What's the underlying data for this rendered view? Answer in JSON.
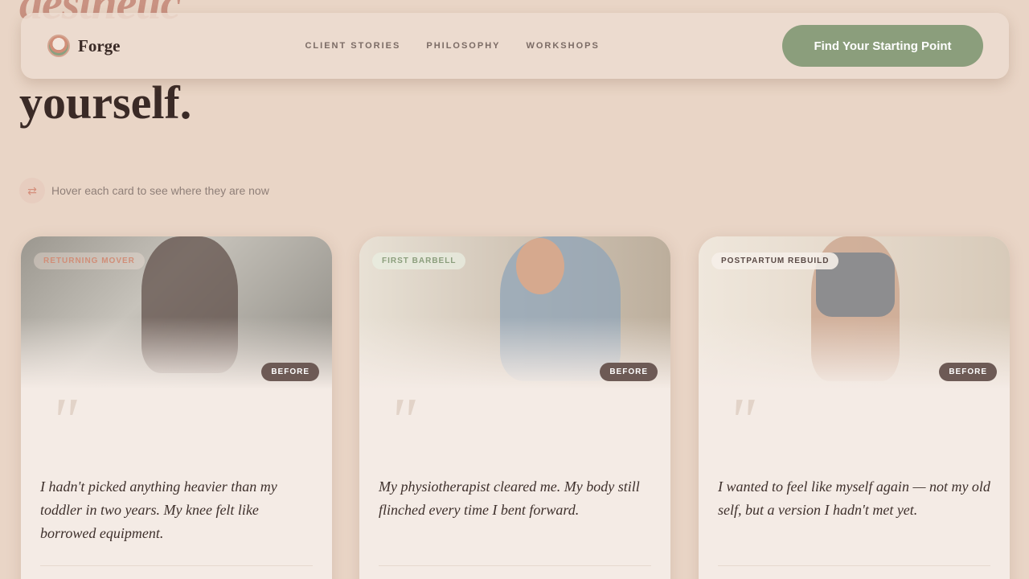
{
  "hero": {
    "line_top": "aesthetic",
    "line_bottom": "yourself."
  },
  "nav": {
    "brand": "Forge",
    "links": [
      "CLIENT STORIES",
      "PHILOSOPHY",
      "WORKSHOPS"
    ],
    "cta": "Find Your Starting Point"
  },
  "hint": {
    "icon": "swap-arrows-icon",
    "text": "Hover each card to see where they are now"
  },
  "cards": [
    {
      "tag": "RETURNING MOVER",
      "tag_color": "#d08e78",
      "badge": "BEFORE",
      "quote": "I hadn't picked anything heavier than my toddler in two years. My knee felt like borrowed equipment."
    },
    {
      "tag": "FIRST BARBELL",
      "tag_color": "#8b9e7c",
      "badge": "BEFORE",
      "quote": "My physiotherapist cleared me. My body still flinched every time I bent forward."
    },
    {
      "tag": "POSTPARTUM REBUILD",
      "tag_color": "#5a4a46",
      "badge": "BEFORE",
      "quote": "I wanted to feel like myself again — not my old self, but a version I hadn't met yet."
    }
  ],
  "colors": {
    "background": "#e9d5c6",
    "accent_sage": "#8b9e7c",
    "accent_terracotta": "#d08e78",
    "text_dark": "#3a2a26"
  }
}
